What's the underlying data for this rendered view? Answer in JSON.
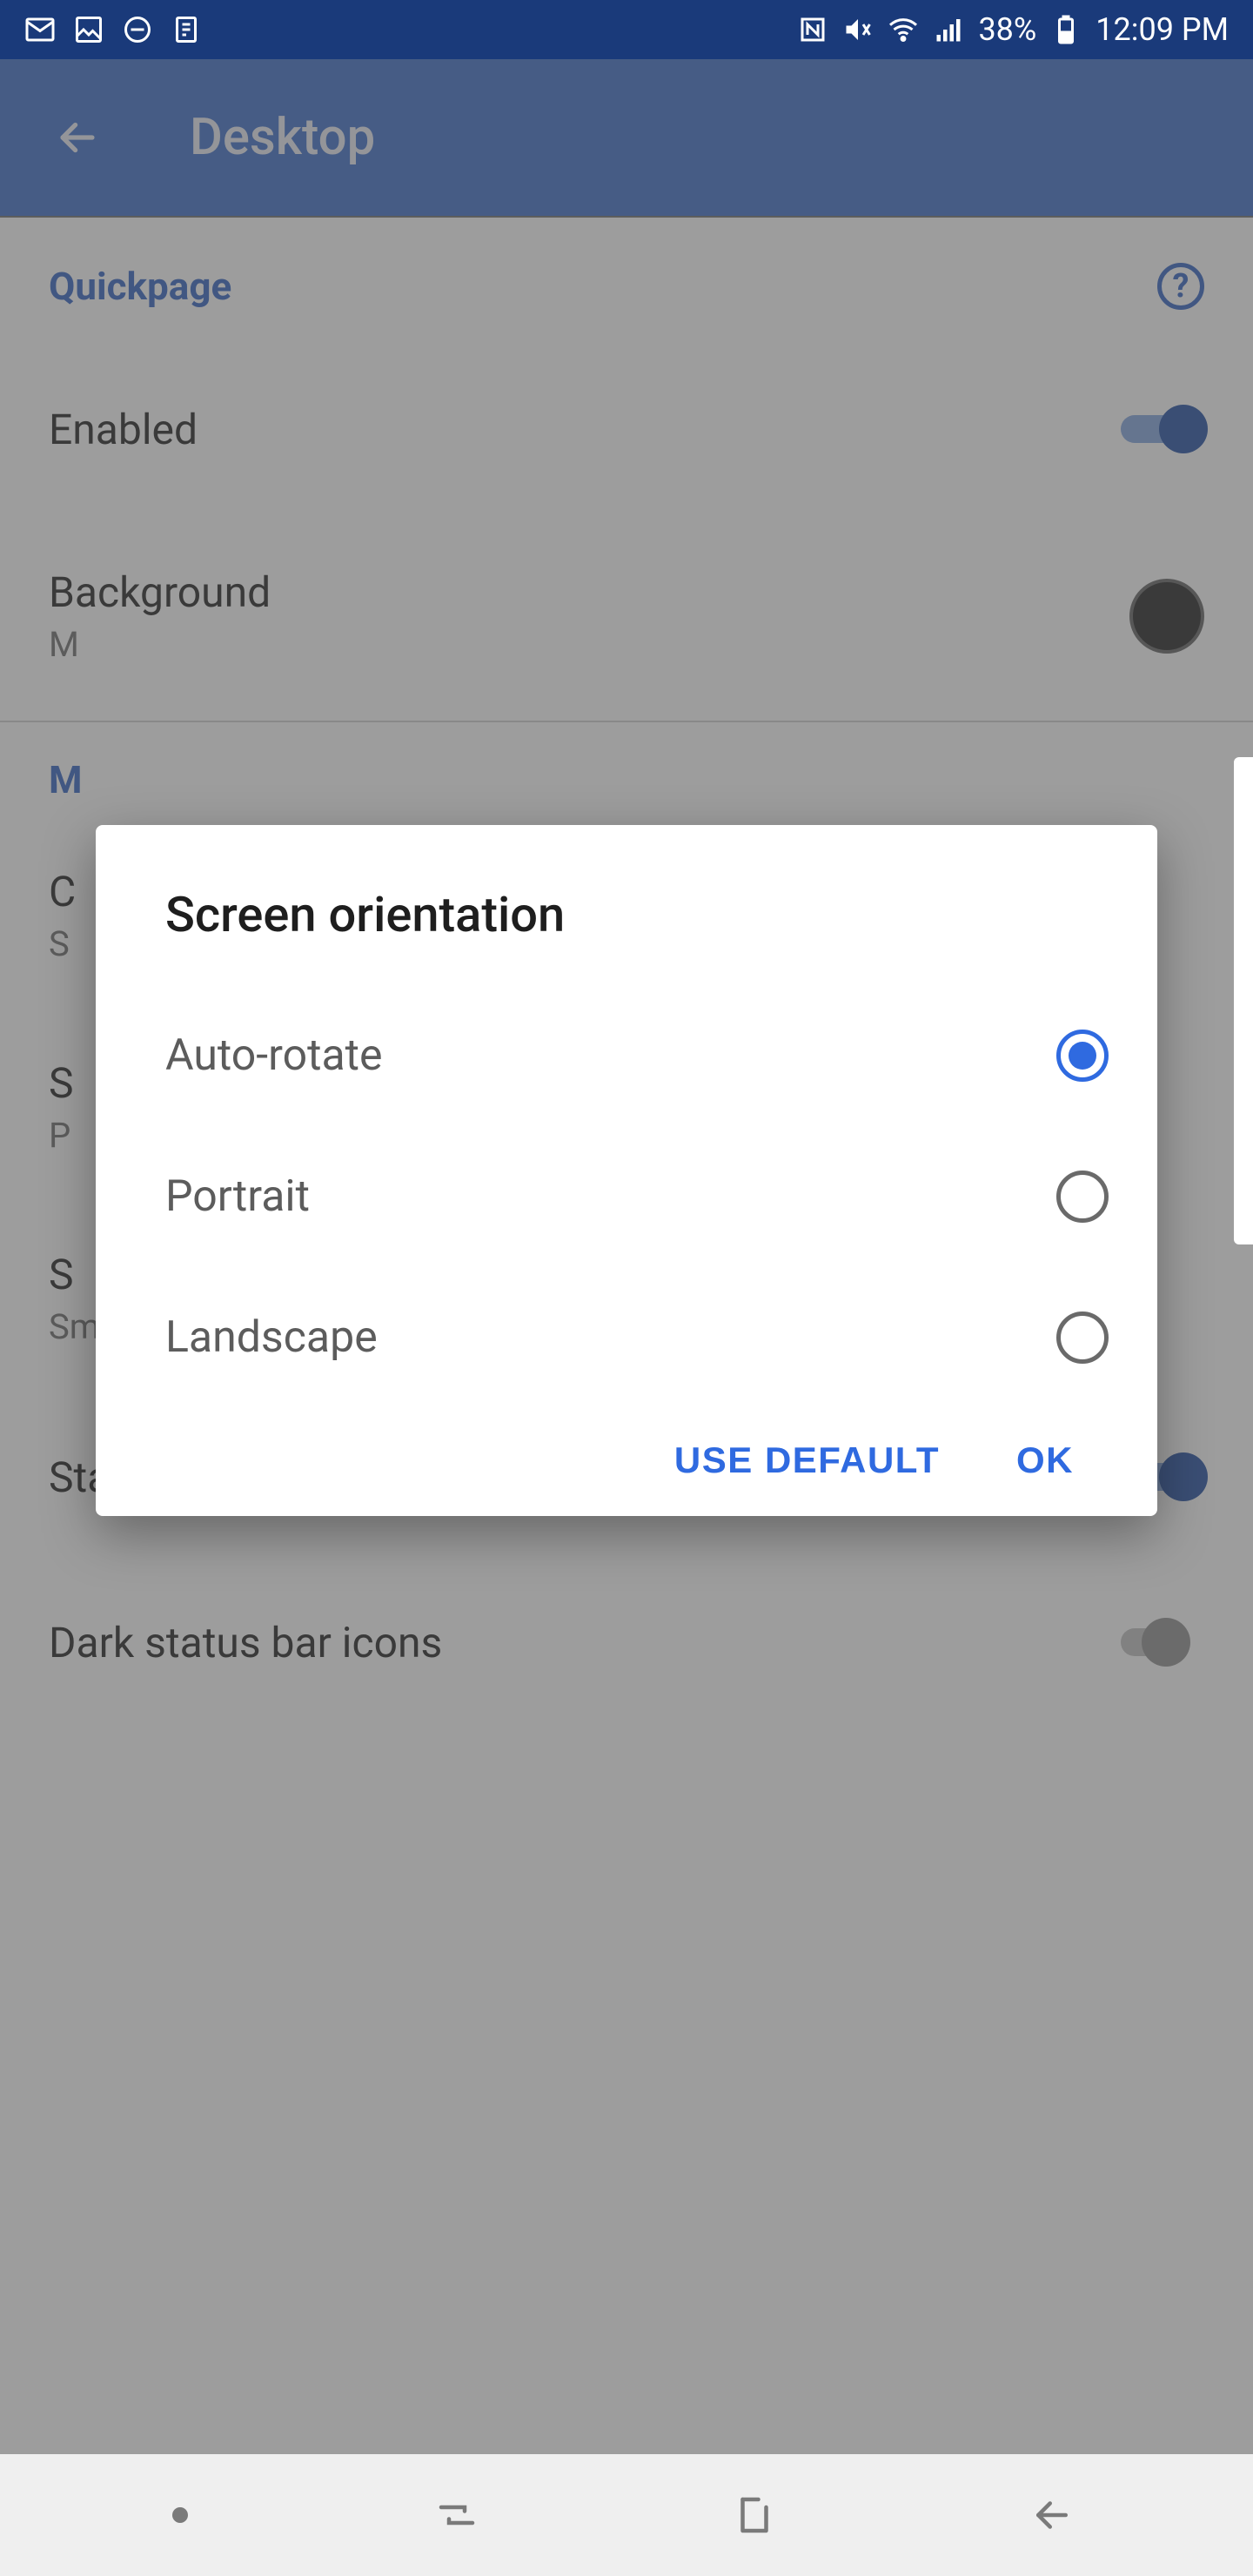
{
  "status_bar": {
    "battery_pct": "38%",
    "clock": "12:09 PM"
  },
  "app_bar": {
    "title": "Desktop"
  },
  "sections": {
    "quickpage": {
      "header": "Quickpage",
      "enabled_label": "Enabled",
      "background_label": "Background",
      "background_sub": "M"
    },
    "more": {
      "header": "M",
      "row_c_label": "C",
      "row_c_sub": "S",
      "row_s_label": "S",
      "row_s_sub": "P",
      "row_s2_label": "S",
      "row_s2_sub": "Small",
      "statusbar_label": "Status bar",
      "dark_icons_label": "Dark status bar icons"
    }
  },
  "dialog": {
    "title": "Screen orientation",
    "options": [
      {
        "label": "Auto-rotate",
        "selected": true
      },
      {
        "label": "Portrait",
        "selected": false
      },
      {
        "label": "Landscape",
        "selected": false
      }
    ],
    "use_default": "USE DEFAULT",
    "ok": "OK"
  }
}
